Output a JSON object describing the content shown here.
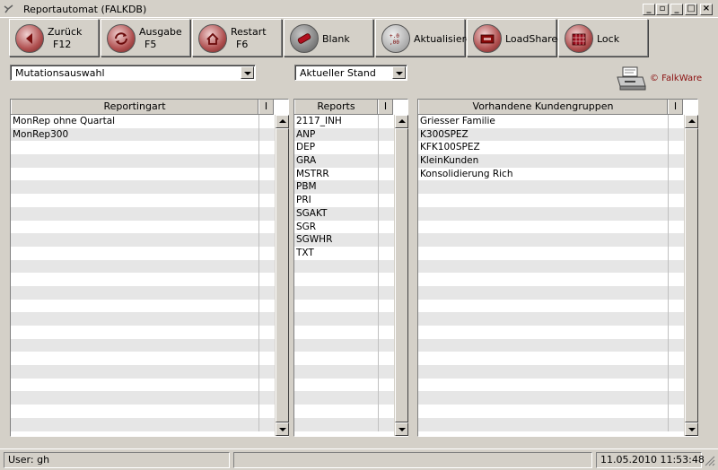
{
  "window": {
    "title": "Reportautomat   (FALKDB)",
    "controls": [
      "_",
      "▢",
      "_",
      "□",
      "×"
    ]
  },
  "toolbar": [
    {
      "name": "back-button",
      "label": "Zurück",
      "shortcut": "F12",
      "icon": "arrow-left-icon"
    },
    {
      "name": "output-button",
      "label": "Ausgabe",
      "shortcut": "F5",
      "icon": "refresh-icon"
    },
    {
      "name": "restart-button",
      "label": "Restart",
      "shortcut": "F6",
      "icon": "restart-icon"
    },
    {
      "name": "blank-button",
      "label": "Blank",
      "shortcut": "",
      "icon": "eraser-icon"
    },
    {
      "name": "refresh-button",
      "label": "Aktualisiere",
      "shortcut": "",
      "icon": "update-icon"
    },
    {
      "name": "load-shared-button",
      "label": "LoadShared",
      "shortcut": "",
      "icon": "load-icon"
    },
    {
      "name": "lock-button",
      "label": "Lock",
      "shortcut": "",
      "icon": "lock-icon"
    }
  ],
  "filters": {
    "mutation": "Mutationsauswahl",
    "state": "Aktueller Stand"
  },
  "logo": {
    "text": "© FalkWare"
  },
  "grids": {
    "reportingart": {
      "header": "Reportingart",
      "flag_header": "I",
      "rows": [
        "MonRep ohne Quartal",
        "MonRep300"
      ]
    },
    "reports": {
      "header": "Reports",
      "flag_header": "I",
      "rows": [
        "2117_INH",
        "ANP",
        "DEP",
        "GRA",
        "MSTRR",
        "PBM",
        "PRI",
        "SGAKT",
        "SGR",
        "SGWHR",
        "TXT"
      ]
    },
    "kundengruppen": {
      "header": "Vorhandene Kundengruppen",
      "flag_header": "I",
      "rows": [
        "Griesser Familie",
        "K300SPEZ",
        "KFK100SPEZ",
        "KleinKunden",
        "Konsolidierung Rich"
      ]
    }
  },
  "status": {
    "user": "User: gh",
    "datetime": "11.05.2010 11:53:48"
  }
}
